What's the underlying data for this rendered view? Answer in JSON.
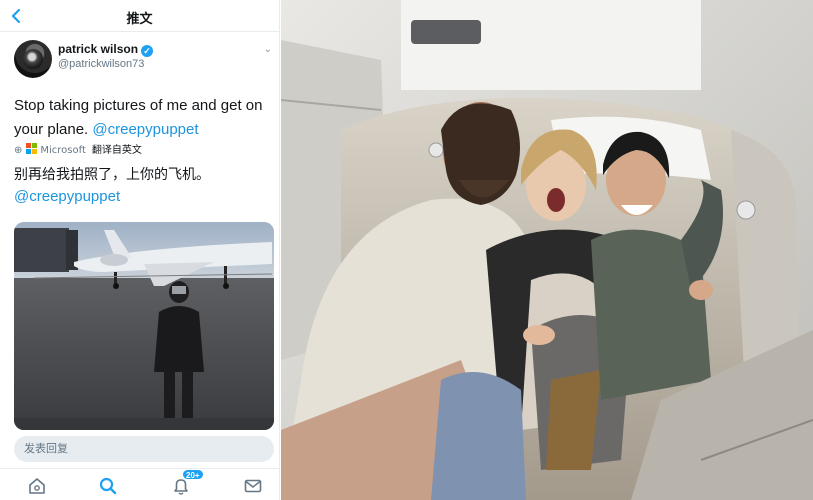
{
  "nav": {
    "title": "推文"
  },
  "tweet": {
    "author_name": "patrick wilson",
    "handle": "@patrickwilson73",
    "text_prefix": "Stop taking pictures of me and get on your plane. ",
    "text_mention": "@creepypuppet",
    "translation": {
      "provider": "Microsoft",
      "label": "翻译自英文"
    },
    "translated_line1": "别再给我拍照了，上你的飞机。",
    "translated_mention": "@creepypuppet"
  },
  "reply": {
    "placeholder": "发表回复"
  },
  "tabbar": {
    "notifications_badge": "20+"
  },
  "colors": {
    "accent": "#1da1f2",
    "link": "#1b95e0"
  },
  "icons": {
    "back": "chevron-left-icon",
    "verified": "verified-badge-icon",
    "translate": "globe-icon",
    "tabs": [
      "home-icon",
      "search-icon",
      "notifications-icon",
      "messages-icon"
    ]
  }
}
